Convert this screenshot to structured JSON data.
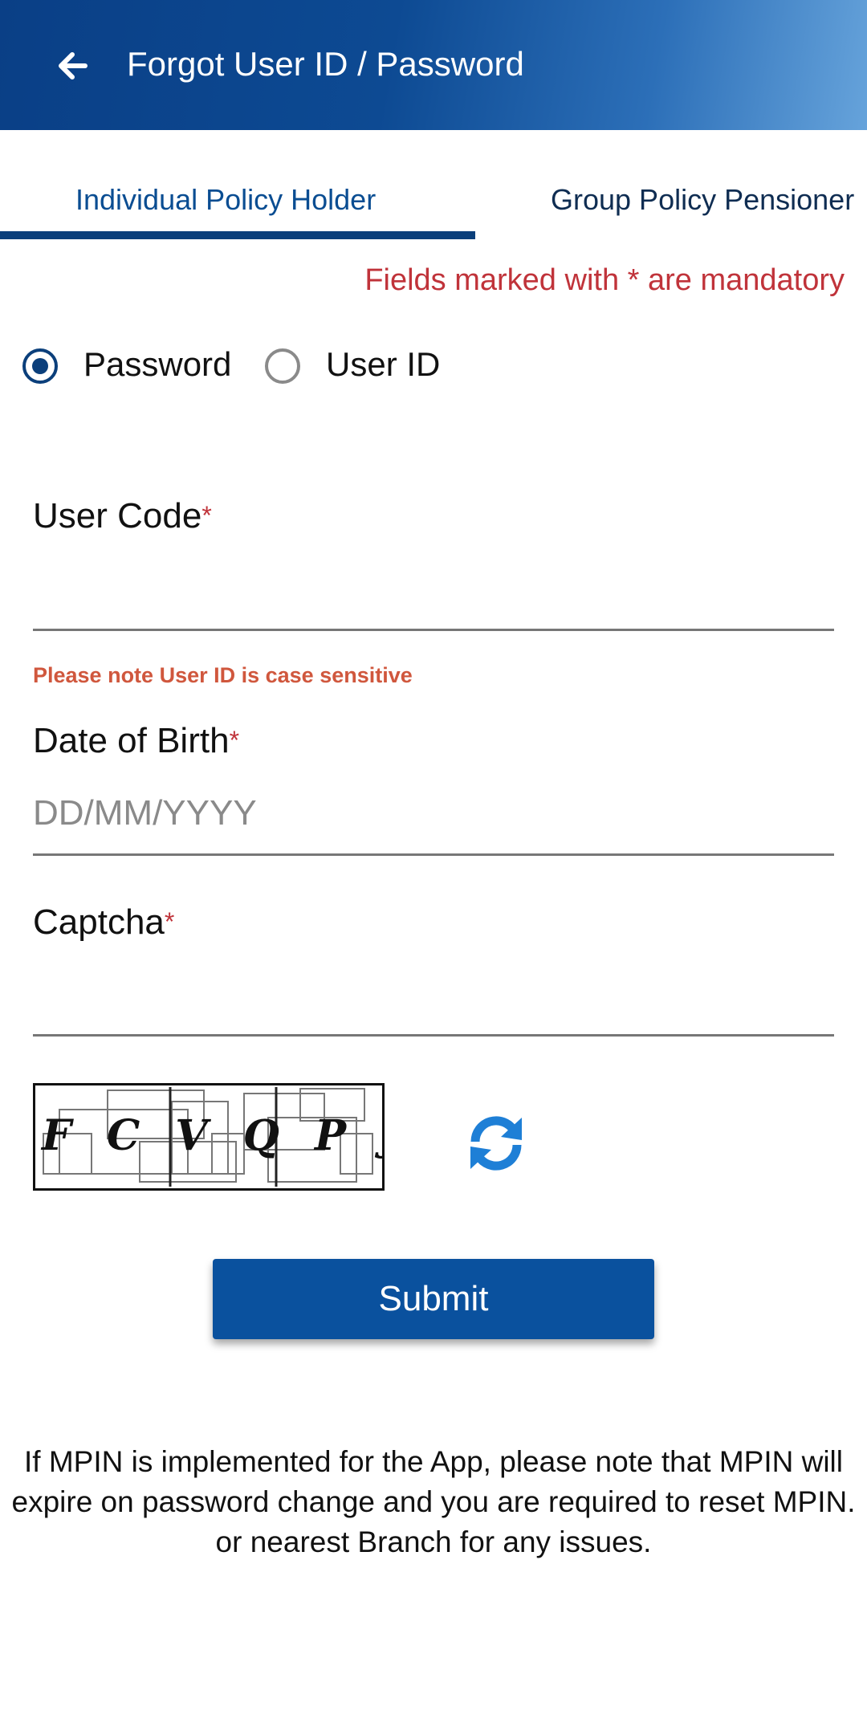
{
  "appbar": {
    "title": "Forgot User ID / Password",
    "back_icon": "arrow-left-icon"
  },
  "tabs": [
    {
      "label": "Individual Policy Holder",
      "active": true
    },
    {
      "label": "Group Policy Pensioner",
      "active": false
    }
  ],
  "mandatory_note": "Fields marked with * are mandatory",
  "recovery_options": {
    "selected": "Password",
    "options": [
      "Password",
      "User ID"
    ]
  },
  "form": {
    "user_code": {
      "label": "User Code",
      "required_mark": "*",
      "value": "",
      "hint": "Please note User ID is case sensitive"
    },
    "dob": {
      "label": "Date of Birth",
      "required_mark": "*",
      "placeholder": "DD/MM/YYYY",
      "value": ""
    },
    "captcha": {
      "label": "Captcha",
      "required_mark": "*",
      "value": "",
      "image_text": "FCVQPJ",
      "refresh_icon": "refresh-icon"
    }
  },
  "submit_label": "Submit",
  "mpin_note": {
    "line1": "If MPIN is implemented for the App, please note that MPIN will expire on password change and you are required to reset MPIN.",
    "line2": "or nearest Branch for any issues."
  },
  "colors": {
    "primary": "#0a519e",
    "tab_underline": "#0b3f7b",
    "error": "#c0333a",
    "hint": "#d0573d",
    "refresh": "#1e7fd6"
  }
}
